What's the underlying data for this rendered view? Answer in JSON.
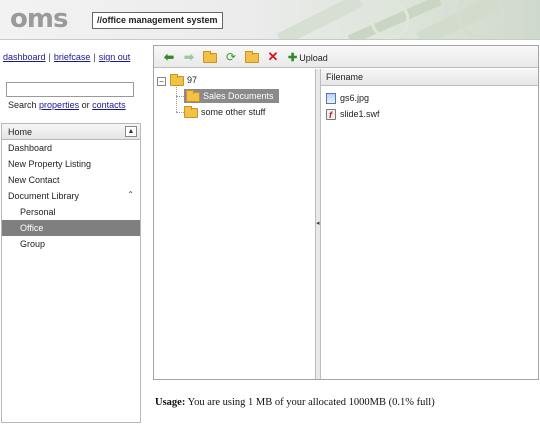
{
  "app": {
    "logo": "oms",
    "tagline": "//office management system"
  },
  "toplinks": {
    "dashboard": "dashboard",
    "briefcase": "briefcase",
    "signout": "sign out",
    "separator": "|"
  },
  "search": {
    "value": "",
    "caption_prefix": "Search",
    "properties_link": "properties",
    "or": "or",
    "contacts_link": "contacts"
  },
  "nav": {
    "header": "Home",
    "items": [
      {
        "label": "Dashboard"
      },
      {
        "label": "New Property Listing"
      },
      {
        "label": "New Contact"
      },
      {
        "label": "Document Library"
      }
    ],
    "subitems": [
      {
        "label": "Personal"
      },
      {
        "label": "Office"
      },
      {
        "label": "Group"
      }
    ],
    "active": "Office"
  },
  "filemanager": {
    "toolbar": {
      "upload_label": "Upload"
    },
    "tree": {
      "root": "97",
      "children": [
        "Sales Documents",
        "some other stuff"
      ],
      "selected": "Sales Documents"
    },
    "list": {
      "column_filename": "Filename",
      "files": [
        {
          "name": "gs6.jpg",
          "icon": "image-file-icon"
        },
        {
          "name": "slide1.swf",
          "icon": "flash-file-icon"
        }
      ]
    }
  },
  "usage": {
    "label": "Usage:",
    "text": "You are using 1 MB of your allocated 1000MB (0.1% full)"
  }
}
